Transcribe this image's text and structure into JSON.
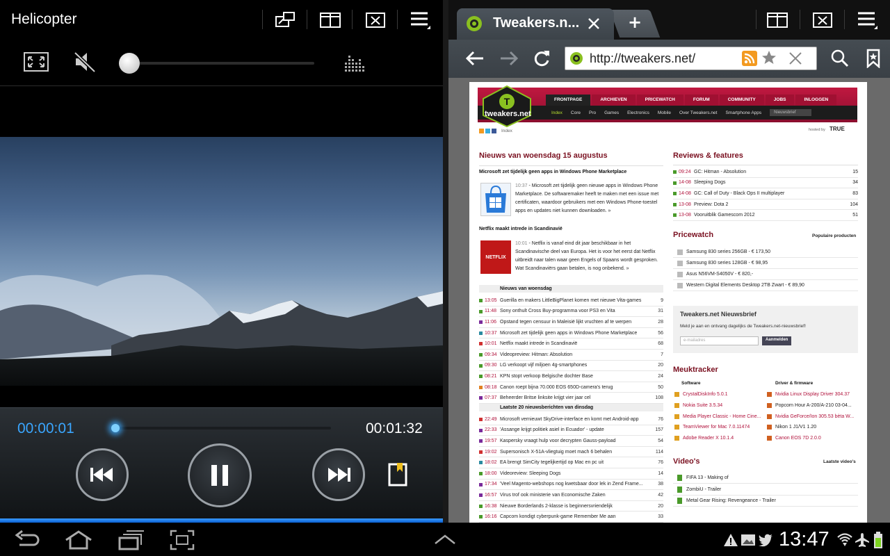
{
  "player": {
    "title": "Helicopter",
    "time_elapsed": "00:00:01",
    "time_total": "00:01:32",
    "volume_level": 0.0,
    "progress_fraction": 0.01,
    "muted": true,
    "accent_color": "#3aa6ff"
  },
  "browser": {
    "tab_title": "Tweakers.n...",
    "new_tab_label": "+",
    "url": "http://tweakers.net/"
  },
  "page": {
    "logo_text": "tweakers.net",
    "menu": [
      "FRONTPAGE",
      "ARCHIEVEN",
      "PRICEWATCH",
      "FORUM",
      "COMMUNITY",
      "JOBS",
      "INLOGGEN"
    ],
    "submenu": [
      "Index",
      "Core",
      "Pro",
      "Games",
      "Electronics",
      "Mobile",
      "Over Tweakers.net",
      "Smartphone Apps"
    ],
    "search_placeholder": "Nieuwsbrief",
    "crumb": "Index",
    "hosted_by": "hosted by",
    "hosted_brand": "TRUE",
    "news_heading": "Nieuws van woensdag 15 augustus",
    "story1_title": "Microsoft zet tijdelijk geen apps in Windows Phone Marketplace",
    "story1_time": "10:37",
    "story1_text": "Microsoft zet tijdelijk geen nieuwe apps in Windows Phone Marketplace. De softwaremaker heeft te maken met een issue met certificaten, waardoor gebruikers met een Windows Phone-toestel apps en updates niet kunnen downloaden. »",
    "story2_title": "Netflix maakt intrede in Scandinavië",
    "story2_time": "10:01",
    "story2_text": "Netflix is vanaf eind dit jaar beschikbaar in het Scandinavische deel van Europa. Het is voor het eerst dat Netflix uitbreidt naar talen waar geen Engels of Spaans wordt gesproken. Wat Scandinaviërs gaan betalen, is nog onbekend. »",
    "netflix_logo": "NETFLIX",
    "list1_heading": "Nieuws van woensdag",
    "list1": [
      {
        "time": "13:05",
        "title": "Guerilla en makers LittleBigPlanet komen met nieuwe Vita-games",
        "count": "9",
        "color": "#4a9a2a"
      },
      {
        "time": "11:48",
        "title": "Sony onthult Cross Buy-programma voor PS3 en Vita",
        "count": "31",
        "color": "#4a9a2a"
      },
      {
        "time": "11:06",
        "title": "Opstand tegen censuur in Maleisië lijkt vruchten af te werpen",
        "count": "28",
        "color": "#7a2a9a"
      },
      {
        "time": "10:37",
        "title": "Microsoft zet tijdelijk geen apps in Windows Phone Marketplace",
        "count": "56",
        "color": "#2a8aa0"
      },
      {
        "time": "10:01",
        "title": "Netflix maakt intrede in Scandinavië",
        "count": "68",
        "color": "#d03030"
      },
      {
        "time": "09:34",
        "title": "Videopreview: Hitman: Absolution",
        "count": "7",
        "color": "#4a9a2a"
      },
      {
        "time": "09:30",
        "title": "LG verkoopt vijf miljoen 4g-smartphones",
        "count": "20",
        "color": "#4a9a2a"
      },
      {
        "time": "08:21",
        "title": "KPN stopt verkoop Belgische dochter Base",
        "count": "24",
        "color": "#4a9a2a"
      },
      {
        "time": "08:18",
        "title": "Canon roept bijna 70.000 EOS 650D-camera's terug",
        "count": "50",
        "color": "#e08020"
      },
      {
        "time": "07:37",
        "title": "Beheerder Britse linksite krijgt vier jaar cel",
        "count": "108",
        "color": "#7a2a9a"
      }
    ],
    "list2_heading": "Laatste 20 nieuwsberichten van dinsdag",
    "list2": [
      {
        "time": "22:49",
        "title": "Microsoft vernieuwt SkyDrive-interface en komt met Android-app",
        "count": "76",
        "color": "#d03030"
      },
      {
        "time": "22:33",
        "title": "'Assange krijgt politiek asiel in Ecuador' - update",
        "count": "157",
        "color": "#7a2a9a"
      },
      {
        "time": "19:57",
        "title": "Kaspersky vraagt hulp voor decrypten Gauss-payload",
        "count": "54",
        "color": "#7a2a9a"
      },
      {
        "time": "19:02",
        "title": "Supersonisch X-51A-vliegtuig moet mach 6 behalen",
        "count": "114",
        "color": "#d03030"
      },
      {
        "time": "18:02",
        "title": "EA brengt SimCity tegelijkertijd op Mac en pc uit",
        "count": "76",
        "color": "#2a8aa0"
      },
      {
        "time": "18:00",
        "title": "Videoreview: Sleeping Dogs",
        "count": "14",
        "color": "#4a9a2a"
      },
      {
        "time": "17:34",
        "title": "'Veel Magento-webshops nog kwetsbaar door lek in Zend Frame...",
        "count": "38",
        "color": "#7a2a9a"
      },
      {
        "time": "16:57",
        "title": "Virus trof ook ministerie van Economische Zaken",
        "count": "42",
        "color": "#7a2a9a"
      },
      {
        "time": "16:38",
        "title": "Nieuwe Borderlands 2-klasse is beginnersvriendelijk",
        "count": "20",
        "color": "#4a9a2a"
      },
      {
        "time": "16:16",
        "title": "Capcom kondigt cyberpunk-game Remember Me aan",
        "count": "33",
        "color": "#4a9a2a"
      }
    ],
    "reviews_heading": "Reviews & features",
    "reviews": [
      {
        "time": "09:24",
        "title": "GC: Hitman - Absolution",
        "count": "15"
      },
      {
        "time": "14-08",
        "title": "Sleeping Dogs",
        "count": "34"
      },
      {
        "time": "14-08",
        "title": "GC: Call of Duty - Black Ops II multiplayer",
        "count": "83"
      },
      {
        "time": "13-08",
        "title": "Preview: Dota 2",
        "count": "104"
      },
      {
        "time": "13-08",
        "title": "Vooruitblik Gamescom 2012",
        "count": "51"
      }
    ],
    "pw_heading": "Pricewatch",
    "pw_link": "Populaire producten",
    "pw_items": [
      "Samsung 830 series 256GB - € 173,50",
      "Samsung 830 series 128GB - € 98,95",
      "Asus N56VM-S4050V - € 820,-",
      "Western Digital Elements Desktop 2TB Zwart - € 89,90"
    ],
    "nl_heading": "Tweakers.net Nieuwsbrief",
    "nl_text": "Meld je aan en ontvang dagelijks de Tweakers.net-nieuwsbrief!",
    "nl_placeholder": "e-mailadres",
    "nl_button": "Aanmelden",
    "mt_heading": "Meuktracker",
    "mt_col1_heading": "Software",
    "mt_col2_heading": "Driver & firmware",
    "mt_col1": [
      "CrystalDiskInfo 5.0.1",
      "Nokia Suite 3.5.34",
      "Media Player Classic - Home Cine...",
      "TeamViewer for Mac 7.0.11474",
      "Adobe Reader X 10.1.4"
    ],
    "mt_col2": [
      "Nvidia Linux Display Driver 304.37",
      "Popcorn Hour A-200/A-210 03-04...",
      "Nvidia GeForce/Ion 305.53 bèta W...",
      "Nikon 1 J1/V1 1.20",
      "Canon EOS 7D 2.0.0"
    ],
    "video_heading": "Video's",
    "video_link": "Laatste video's",
    "videos": [
      "FIFA 13 - Making of",
      "ZombiU - Trailer",
      "Metal Gear Rising: Revengeance - Trailer"
    ]
  },
  "system": {
    "clock": "13:47"
  }
}
